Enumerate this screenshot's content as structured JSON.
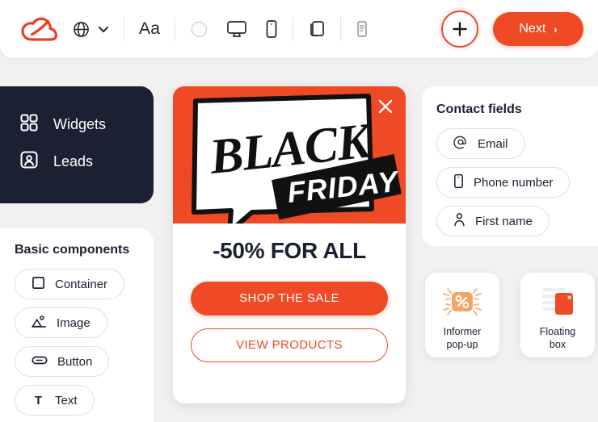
{
  "brand": {
    "accent": "#ef4a25",
    "accent_light": "#f5a463",
    "dark": "#1c2033",
    "page_bg": "#f1f1f1"
  },
  "toolbar": {
    "logo_icon": "cloud-logo-icon",
    "language_icon": "globe-icon",
    "language_caret_icon": "chevron-down-icon",
    "typography_label": "Aa",
    "color_icon": "color-circle-icon",
    "desktop_icon": "desktop-monitor-icon",
    "mobile_icon": "mobile-phone-icon",
    "duplicate_icon": "copy-pages-icon",
    "form_icon": "form-document-icon",
    "add_icon": "plus-icon",
    "next_label": "Next",
    "next_chevron": "›"
  },
  "nav_panel": {
    "items": [
      {
        "label": "Widgets",
        "icon": "grid-widgets-icon"
      },
      {
        "label": "Leads",
        "icon": "person-card-icon"
      }
    ]
  },
  "basic_components": {
    "title": "Basic components",
    "items": [
      {
        "label": "Container",
        "icon": "square-container-icon"
      },
      {
        "label": "Image",
        "icon": "image-mountain-icon"
      },
      {
        "label": "Button",
        "icon": "button-pill-icon"
      },
      {
        "label": "Text",
        "icon": "text-t-icon"
      }
    ]
  },
  "popup_preview": {
    "close_icon": "close-x-icon",
    "banner": {
      "word_top": "BLACK",
      "word_bottom": "FRIDAY",
      "background": "#ef4a25"
    },
    "headline": "-50% FOR ALL",
    "primary_button": "SHOP THE SALE",
    "secondary_button": "VIEW PRODUCTS"
  },
  "contact_fields": {
    "title": "Contact fields",
    "items": [
      {
        "label": "Email",
        "icon": "at-sign-icon"
      },
      {
        "label": "Phone number",
        "icon": "phone-icon"
      },
      {
        "label": "First name",
        "icon": "person-icon"
      }
    ]
  },
  "widget_types": [
    {
      "label": "Informer\npop-up",
      "line1": "Informer",
      "line2": "pop-up",
      "icon": "percent-badge-icon"
    },
    {
      "label": "Floating\nbox",
      "line1": "Floating",
      "line2": "box",
      "icon": "floating-box-icon"
    }
  ]
}
